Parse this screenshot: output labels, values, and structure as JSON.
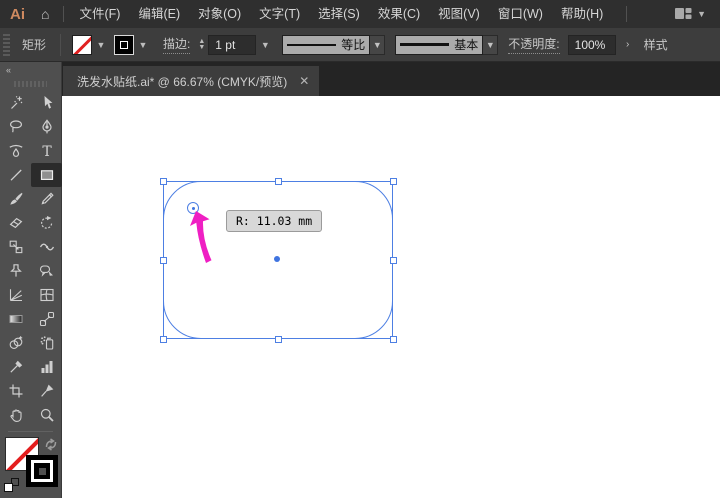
{
  "menubar": {
    "logo": "Ai",
    "items": [
      "文件(F)",
      "编辑(E)",
      "对象(O)",
      "文字(T)",
      "选择(S)",
      "效果(C)",
      "视图(V)",
      "窗口(W)",
      "帮助(H)"
    ]
  },
  "controlbar": {
    "tool_label": "矩形",
    "stroke_label": "描边:",
    "stroke_weight": "1 pt",
    "profile_value": "等比",
    "brush_value": "基本",
    "opacity_label": "不透明度:",
    "opacity_value": "100%",
    "expand_arrow": "›",
    "style_label": "样式"
  },
  "tab": {
    "title": "洗发水贴纸.ai* @ 66.67% (CMYK/预览)",
    "close": "✕"
  },
  "toolbar": {
    "collapse": "«",
    "tools": [
      "magic-wand",
      "selection",
      "lasso",
      "pen",
      "curvature",
      "type",
      "line-segment",
      "rectangle",
      "paintbrush",
      "pencil",
      "eraser",
      "rotate",
      "scale",
      "width",
      "shaper",
      "puppet-warp",
      "perspective-grid",
      "mesh",
      "gradient",
      "blend",
      "shape-builder",
      "symbol-sprayer",
      "eyedropper",
      "graph",
      "artboard",
      "slice",
      "hand",
      "zoom"
    ],
    "active_tool": "rectangle",
    "fill": "none",
    "stroke": "black"
  },
  "canvas": {
    "tooltip": "R: 11.03 mm",
    "selection_color": "#4d7fe3",
    "arrow_color": "#ef1fc3",
    "corner_radius_label": "R: 11.03 mm"
  }
}
